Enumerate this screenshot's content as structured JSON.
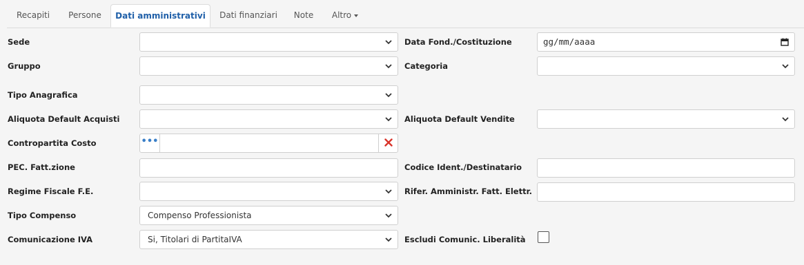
{
  "tabs": [
    "Recapiti",
    "Persone",
    "Dati amministrativi",
    "Dati finanziari",
    "Note",
    "Altro"
  ],
  "fields": {
    "sede": {
      "label": "Sede",
      "value": ""
    },
    "data_fond": {
      "label": "Data Fond./Costituzione",
      "placeholder": "gg/mm/aaaa"
    },
    "gruppo": {
      "label": "Gruppo",
      "value": ""
    },
    "categoria": {
      "label": "Categoria",
      "value": ""
    },
    "tipo_anagrafica": {
      "label": "Tipo Anagrafica",
      "value": ""
    },
    "aliq_acquisti": {
      "label": "Aliquota Default Acquisti",
      "value": ""
    },
    "aliq_vendite": {
      "label": "Aliquota Default Vendite",
      "value": ""
    },
    "contropartita": {
      "label": "Contropartita Costo",
      "value": ""
    },
    "pec": {
      "label": "PEC. Fatt.zione",
      "value": ""
    },
    "codice_dest": {
      "label": "Codice Ident./Destinatario",
      "value": ""
    },
    "regime": {
      "label": "Regime Fiscale F.E.",
      "value": ""
    },
    "rifer": {
      "label": "Rifer. Amministr. Fatt. Elettr.",
      "value": ""
    },
    "tipo_compenso": {
      "label": "Tipo Compenso",
      "value": "Compenso Professionista"
    },
    "com_iva": {
      "label": "Comunicazione IVA",
      "value": "Si, Titolari di PartitaIVA"
    },
    "escludi": {
      "label": "Escludi Comunic. Liberalità",
      "checked": false
    }
  },
  "colors": {
    "active_tab": "#1f5fa8",
    "clear_icon": "#d9342b",
    "lookup_icon": "#3a7fc8"
  }
}
